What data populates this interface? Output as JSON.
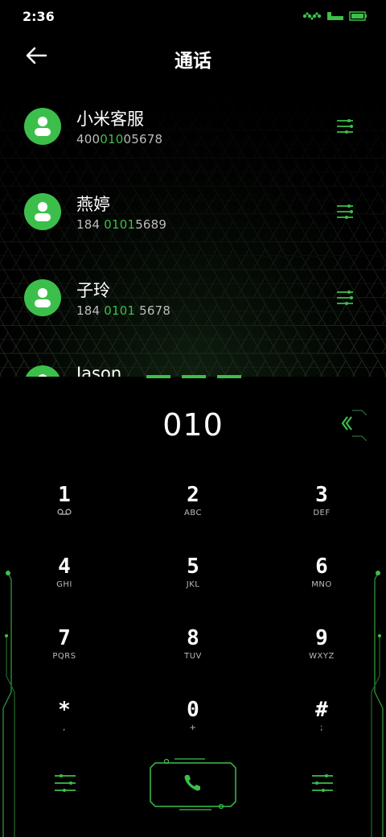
{
  "status": {
    "time": "2:36"
  },
  "header": {
    "title": "通话"
  },
  "contacts": [
    {
      "name": "小米客服",
      "num_pre": "400",
      "num_hl": "010",
      "num_post": "05678"
    },
    {
      "name": "燕婷",
      "num_pre": "184 ",
      "num_hl": "0101",
      "num_post": "5689"
    },
    {
      "name": "子玲",
      "num_pre": "184 ",
      "num_hl": "0101",
      "num_post": " 5678"
    },
    {
      "name": "Jason",
      "num_pre": "",
      "num_hl": "",
      "num_post": ""
    }
  ],
  "dialer": {
    "number": "010"
  },
  "keys": [
    {
      "digit": "1",
      "letters": ""
    },
    {
      "digit": "2",
      "letters": "ABC"
    },
    {
      "digit": "3",
      "letters": "DEF"
    },
    {
      "digit": "4",
      "letters": "GHI"
    },
    {
      "digit": "5",
      "letters": "JKL"
    },
    {
      "digit": "6",
      "letters": "MNO"
    },
    {
      "digit": "7",
      "letters": "PQRS"
    },
    {
      "digit": "8",
      "letters": "TUV"
    },
    {
      "digit": "9",
      "letters": "WXYZ"
    },
    {
      "digit": "*",
      "letters": ","
    },
    {
      "digit": "0",
      "letters": "+"
    },
    {
      "digit": "#",
      "letters": ";"
    }
  ],
  "colors": {
    "accent": "#3cbf4a",
    "background": "#000000",
    "text": "#ffffff",
    "subtext": "#bdbdbd"
  },
  "icons": {
    "back": "arrow-left-icon",
    "contact": "person-icon",
    "more": "sliders-icon",
    "delete": "backspace-icon",
    "call": "phone-icon",
    "voicemail": "voicemail-icon"
  }
}
